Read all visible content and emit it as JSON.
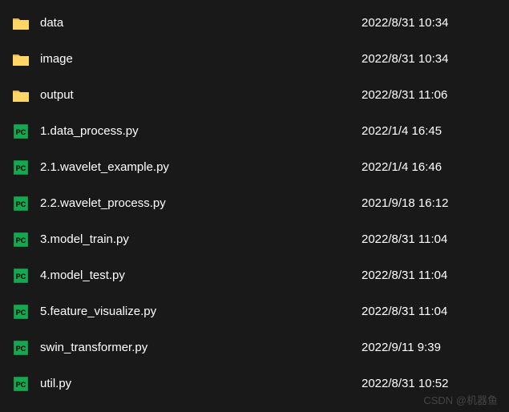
{
  "files": [
    {
      "type": "folder",
      "name": "data",
      "date": "2022/8/31 10:34"
    },
    {
      "type": "folder",
      "name": "image",
      "date": "2022/8/31 10:34"
    },
    {
      "type": "folder",
      "name": "output",
      "date": "2022/8/31 11:06"
    },
    {
      "type": "python",
      "name": "1.data_process.py",
      "date": "2022/1/4 16:45"
    },
    {
      "type": "python",
      "name": "2.1.wavelet_example.py",
      "date": "2022/1/4 16:46"
    },
    {
      "type": "python",
      "name": "2.2.wavelet_process.py",
      "date": "2021/9/18 16:12"
    },
    {
      "type": "python",
      "name": "3.model_train.py",
      "date": "2022/8/31 11:04"
    },
    {
      "type": "python",
      "name": "4.model_test.py",
      "date": "2022/8/31 11:04"
    },
    {
      "type": "python",
      "name": "5.feature_visualize.py",
      "date": "2022/8/31 11:04"
    },
    {
      "type": "python",
      "name": "swin_transformer.py",
      "date": "2022/9/11 9:39"
    },
    {
      "type": "python",
      "name": "util.py",
      "date": "2022/8/31 10:52"
    }
  ],
  "watermark": "CSDN @机器鱼"
}
